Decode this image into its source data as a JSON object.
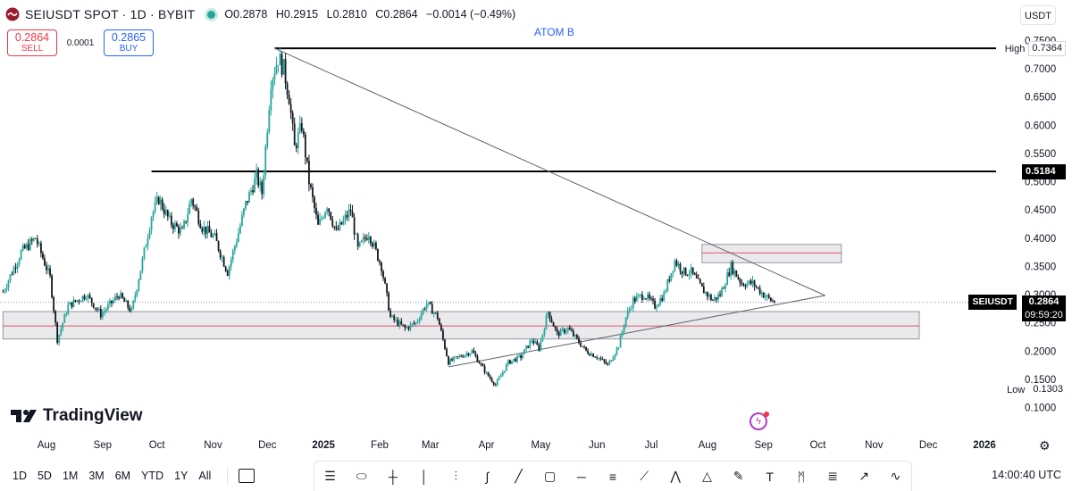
{
  "header": {
    "symbol": "SEIUSDT SPOT · 1D · BYBIT",
    "open": "O0.2878",
    "high": "H0.2915",
    "low": "L0.2810",
    "close": "C0.2864",
    "change": "−0.0014 (−0.49%)"
  },
  "trade": {
    "sell_price": "0.2864",
    "sell_label": "SELL",
    "spread": "0.0001",
    "buy_price": "0.2865",
    "buy_label": "BUY"
  },
  "currency": "USDT",
  "watermark_text": "ATOM B",
  "brand": "TradingView",
  "bottom_bar": {
    "timeframes": [
      "1D",
      "5D",
      "1M",
      "3M",
      "6M",
      "YTD",
      "1Y",
      "All"
    ],
    "clock": "14:00:40 UTC"
  },
  "toolbar_icons": [
    "lines-icon",
    "ellipse-icon",
    "crosshair-icon",
    "vertical-line-icon",
    "candle-icon",
    "brush-icon",
    "trend-line-icon",
    "rectangle-icon",
    "horizontal-line-icon",
    "fib-icon",
    "measure-icon",
    "path-icon",
    "triangle-icon",
    "pen-icon",
    "text-icon",
    "pattern-icon",
    "gann-icon",
    "arrow-icon",
    "curve-icon"
  ],
  "colors": {
    "up": "#26a69a",
    "down": "#131722",
    "sell": "#f23645",
    "buy": "#2962ff",
    "zone_fill": "#e3e3e6",
    "zone_line": "#e0506a"
  },
  "chart_data": {
    "type": "candlestick",
    "y_axis": {
      "range": [
        0.08,
        0.76
      ],
      "ticks": [
        "0.7500",
        "0.7000",
        "0.6500",
        "0.6000",
        "0.5500",
        "0.5000",
        "0.4500",
        "0.4000",
        "0.3500",
        "0.3000",
        "0.2500",
        "0.2000",
        "0.1500",
        "0.1000"
      ],
      "tick_values": [
        0.75,
        0.7,
        0.65,
        0.6,
        0.55,
        0.5,
        0.45,
        0.4,
        0.35,
        0.3,
        0.25,
        0.2,
        0.15,
        0.1
      ]
    },
    "x_axis": {
      "labels": [
        "Aug",
        "Sep",
        "Oct",
        "Nov",
        "Dec",
        "2025",
        "Feb",
        "Mar",
        "Apr",
        "May",
        "Jun",
        "Jul",
        "Aug",
        "Sep",
        "Oct",
        "Nov",
        "Dec",
        "2026"
      ],
      "label_days": [
        0,
        31,
        61,
        92,
        122,
        153,
        184,
        212,
        243,
        273,
        304,
        334,
        365,
        396,
        426,
        457,
        487,
        518
      ],
      "day_range": [
        -24,
        548
      ]
    },
    "price_labels": {
      "high_label": "High",
      "high_value": "0.7364",
      "level_value": "0.5184",
      "symbol_tag": "SEIUSDT",
      "last_price": "0.2864",
      "countdown": "09:59:20",
      "low_label": "Low",
      "low_value": "0.1303"
    },
    "horizontal_levels": [
      {
        "price": 0.7364,
        "day_start": 126,
        "day_end": 548
      },
      {
        "price": 0.5184,
        "day_start": 58,
        "day_end": 548
      }
    ],
    "triangle": {
      "apex": {
        "day": 430,
        "price": 0.2985
      },
      "upper_start": {
        "day": 126,
        "price": 0.7364
      },
      "lower_start": {
        "day": 222,
        "price": 0.172
      }
    },
    "zones": [
      {
        "day_start": -24,
        "day_end": 482,
        "price_top": 0.27,
        "price_bottom": 0.2215,
        "mid": 0.2445
      },
      {
        "day_start": 362,
        "day_end": 439,
        "price_top": 0.389,
        "price_bottom": 0.3565,
        "mid": 0.374
      }
    ],
    "last_price": 0.2864,
    "close_anchors": [
      {
        "day": -24,
        "price": 0.305
      },
      {
        "day": -14,
        "price": 0.375
      },
      {
        "day": -6,
        "price": 0.4
      },
      {
        "day": 2,
        "price": 0.33
      },
      {
        "day": 6,
        "price": 0.22
      },
      {
        "day": 12,
        "price": 0.28
      },
      {
        "day": 22,
        "price": 0.3
      },
      {
        "day": 30,
        "price": 0.265
      },
      {
        "day": 40,
        "price": 0.3
      },
      {
        "day": 47,
        "price": 0.27
      },
      {
        "day": 53,
        "price": 0.36
      },
      {
        "day": 58,
        "price": 0.44
      },
      {
        "day": 62,
        "price": 0.47
      },
      {
        "day": 68,
        "price": 0.43
      },
      {
        "day": 75,
        "price": 0.41
      },
      {
        "day": 80,
        "price": 0.47
      },
      {
        "day": 86,
        "price": 0.42
      },
      {
        "day": 93,
        "price": 0.4
      },
      {
        "day": 100,
        "price": 0.34
      },
      {
        "day": 106,
        "price": 0.41
      },
      {
        "day": 110,
        "price": 0.46
      },
      {
        "day": 116,
        "price": 0.51
      },
      {
        "day": 119,
        "price": 0.48
      },
      {
        "day": 124,
        "price": 0.68
      },
      {
        "day": 128,
        "price": 0.72
      },
      {
        "day": 131,
        "price": 0.7
      },
      {
        "day": 134,
        "price": 0.65
      },
      {
        "day": 137,
        "price": 0.56
      },
      {
        "day": 141,
        "price": 0.6
      },
      {
        "day": 145,
        "price": 0.5
      },
      {
        "day": 150,
        "price": 0.42
      },
      {
        "day": 155,
        "price": 0.46
      },
      {
        "day": 160,
        "price": 0.41
      },
      {
        "day": 168,
        "price": 0.45
      },
      {
        "day": 172,
        "price": 0.38
      },
      {
        "day": 178,
        "price": 0.41
      },
      {
        "day": 185,
        "price": 0.35
      },
      {
        "day": 190,
        "price": 0.26
      },
      {
        "day": 198,
        "price": 0.24
      },
      {
        "day": 204,
        "price": 0.25
      },
      {
        "day": 210,
        "price": 0.285
      },
      {
        "day": 216,
        "price": 0.26
      },
      {
        "day": 222,
        "price": 0.18
      },
      {
        "day": 228,
        "price": 0.19
      },
      {
        "day": 235,
        "price": 0.2
      },
      {
        "day": 243,
        "price": 0.16
      },
      {
        "day": 248,
        "price": 0.14
      },
      {
        "day": 255,
        "price": 0.18
      },
      {
        "day": 262,
        "price": 0.19
      },
      {
        "day": 268,
        "price": 0.22
      },
      {
        "day": 272,
        "price": 0.205
      },
      {
        "day": 277,
        "price": 0.27
      },
      {
        "day": 282,
        "price": 0.23
      },
      {
        "day": 288,
        "price": 0.24
      },
      {
        "day": 293,
        "price": 0.22
      },
      {
        "day": 298,
        "price": 0.2
      },
      {
        "day": 304,
        "price": 0.19
      },
      {
        "day": 310,
        "price": 0.175
      },
      {
        "day": 316,
        "price": 0.21
      },
      {
        "day": 320,
        "price": 0.26
      },
      {
        "day": 324,
        "price": 0.29
      },
      {
        "day": 330,
        "price": 0.3
      },
      {
        "day": 336,
        "price": 0.28
      },
      {
        "day": 341,
        "price": 0.3
      },
      {
        "day": 347,
        "price": 0.36
      },
      {
        "day": 352,
        "price": 0.34
      },
      {
        "day": 356,
        "price": 0.34
      },
      {
        "day": 362,
        "price": 0.31
      },
      {
        "day": 368,
        "price": 0.29
      },
      {
        "day": 372,
        "price": 0.3
      },
      {
        "day": 378,
        "price": 0.35
      },
      {
        "day": 384,
        "price": 0.32
      },
      {
        "day": 390,
        "price": 0.32
      },
      {
        "day": 396,
        "price": 0.3
      },
      {
        "day": 400,
        "price": 0.29
      },
      {
        "day": 402,
        "price": 0.2864
      }
    ]
  }
}
